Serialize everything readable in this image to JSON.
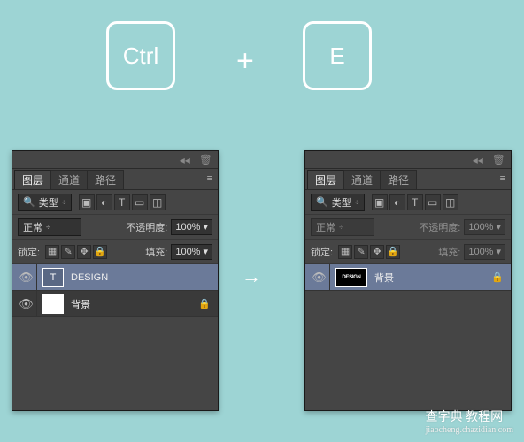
{
  "shortcut": {
    "key1": "Ctrl",
    "plus": "+",
    "key2": "E"
  },
  "arrow": "→",
  "panels": {
    "tabs": {
      "layers": "图层",
      "channels": "通道",
      "paths": "路径"
    },
    "filter_type": "类型",
    "blend_mode": "正常",
    "opacity_label": "不透明度:",
    "opacity_value": "100%",
    "lock_label": "锁定:",
    "fill_label": "填充:",
    "fill_value": "100%"
  },
  "left_layers": [
    {
      "name": "DESIGN",
      "thumb_text": "T"
    },
    {
      "name": "背景"
    }
  ],
  "right_layers": [
    {
      "name": "背景",
      "thumb_text": "DESIGN"
    }
  ],
  "icons": {
    "collapse": "◂◂",
    "trash": "🗑",
    "menu": "≡",
    "chevron": "÷",
    "image": "▣",
    "adjust": "◐",
    "text": "T",
    "shape": "▭",
    "smart": "◫",
    "eye": "👁",
    "lock": "🔒",
    "pixels": "▦",
    "brush": "✎",
    "move": "✥",
    "padlock": "🔒",
    "caret_down": "▾"
  },
  "watermark": {
    "main": "查字典 教程网",
    "url": "jiaocheng.chazidian.com"
  }
}
